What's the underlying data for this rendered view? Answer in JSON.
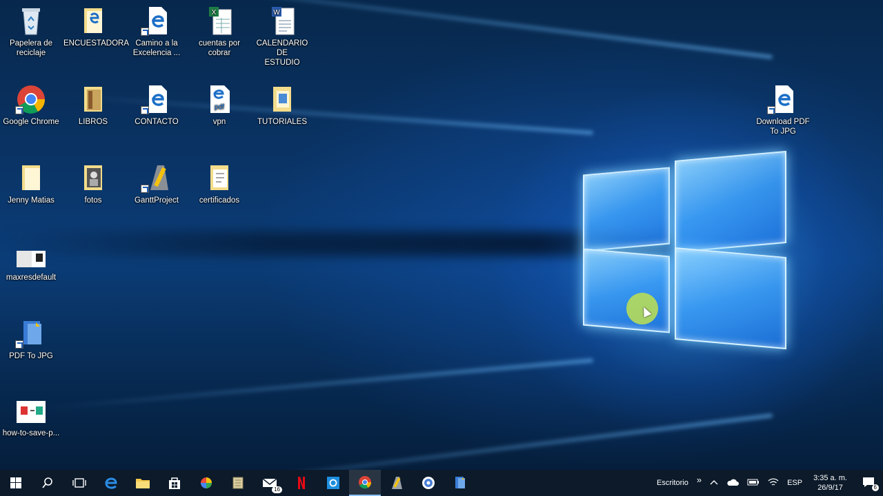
{
  "desktop": {
    "icons": [
      {
        "label": "Papelera de\nreciclaje",
        "icon": "recycle-bin-icon"
      },
      {
        "label": "ENCUESTADORA",
        "icon": "folder-icon"
      },
      {
        "label": "Camino a la\nExcelencia ...",
        "icon": "edge-html-icon"
      },
      {
        "label": "cuentas por\ncobrar",
        "icon": "excel-file-icon"
      },
      {
        "label": "CALENDARIO DE\nESTUDIO",
        "icon": "word-file-icon"
      },
      {
        "label": "Google Chrome",
        "icon": "chrome-icon"
      },
      {
        "label": "LIBROS",
        "icon": "folder-icon"
      },
      {
        "label": "CONTACTO",
        "icon": "edge-html-icon"
      },
      {
        "label": "vpn",
        "icon": "pdf-file-icon"
      },
      {
        "label": "TUTORIALES",
        "icon": "folder-icon"
      },
      {
        "label": "Jenny Matias",
        "icon": "folder-icon"
      },
      {
        "label": "fotos",
        "icon": "folder-icon"
      },
      {
        "label": "GanttProject",
        "icon": "ganttproject-icon"
      },
      {
        "label": "certificados",
        "icon": "folder-icon"
      },
      {
        "label": "maxresdefault",
        "icon": "image-file-icon"
      },
      {
        "label": "PDF To JPG",
        "icon": "pdf-to-jpg-app-icon"
      },
      {
        "label": "how-to-save-p...",
        "icon": "image-file-icon"
      },
      {
        "label": "Download PDF\nTo JPG",
        "icon": "edge-html-icon"
      }
    ]
  },
  "taskbar": {
    "apps": [
      {
        "name": "start",
        "icon": "windows-start-icon"
      },
      {
        "name": "search",
        "icon": "search-icon"
      },
      {
        "name": "task-view",
        "icon": "task-view-icon"
      },
      {
        "name": "edge",
        "icon": "edge-icon"
      },
      {
        "name": "file-explorer",
        "icon": "folder-icon"
      },
      {
        "name": "store",
        "icon": "store-icon"
      },
      {
        "name": "app-colorful",
        "icon": "colorful-app-icon"
      },
      {
        "name": "app-archive",
        "icon": "archive-icon"
      },
      {
        "name": "mail",
        "icon": "mail-icon",
        "badge": "16"
      },
      {
        "name": "netflix",
        "icon": "netflix-icon"
      },
      {
        "name": "app-blue",
        "icon": "blue-app-icon"
      },
      {
        "name": "chrome",
        "icon": "chrome-icon",
        "active": true
      },
      {
        "name": "ganttproject",
        "icon": "ganttproject-icon"
      },
      {
        "name": "app-circle",
        "icon": "circle-app-icon"
      },
      {
        "name": "pdf-to-jpg",
        "icon": "pdf-to-jpg-app-icon"
      }
    ],
    "tray": {
      "desktop_label": "Escritorio",
      "chevron": "»",
      "language": "ESP",
      "time": "3:35 a. m.",
      "date": "26/9/17",
      "notifications": "6"
    }
  }
}
